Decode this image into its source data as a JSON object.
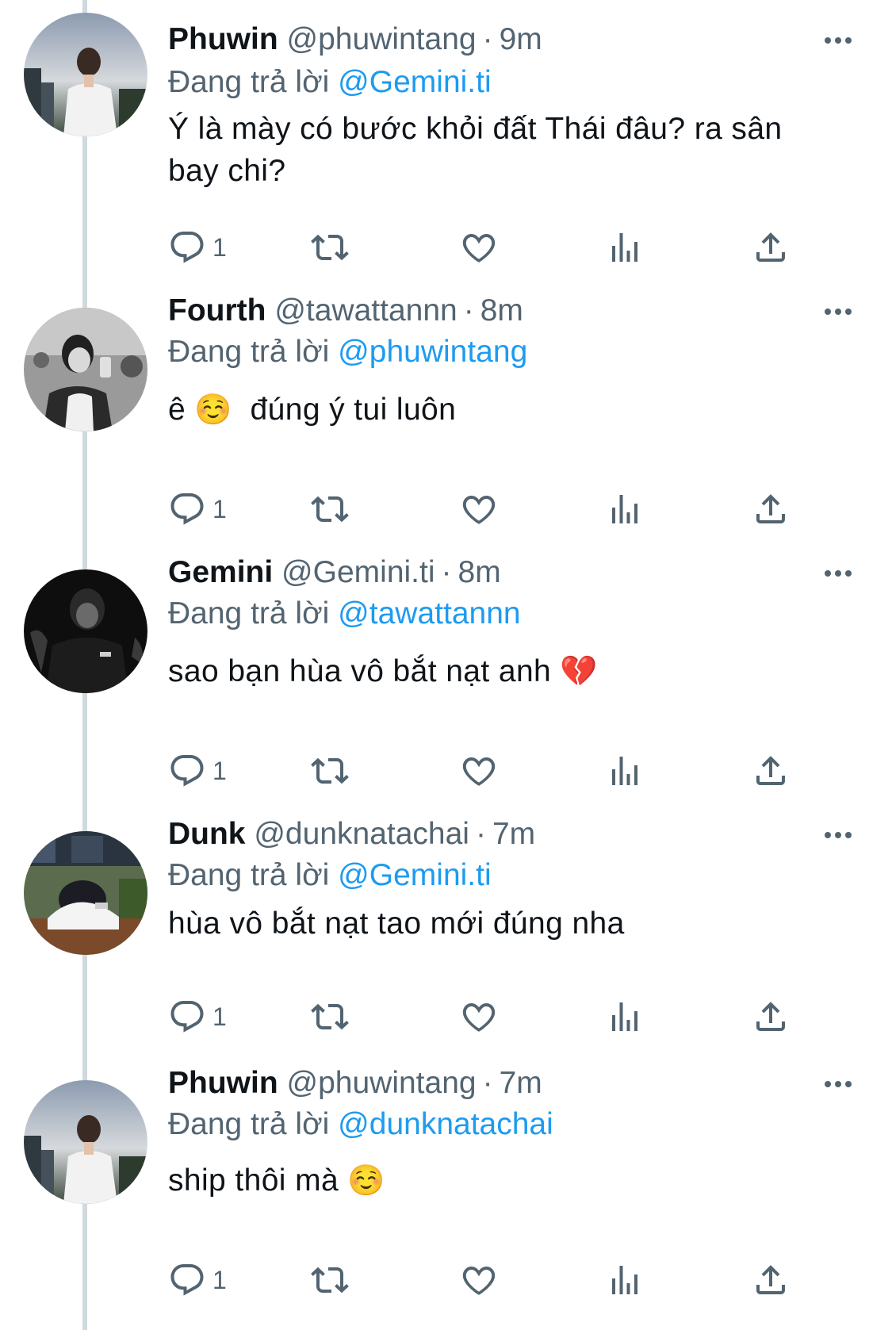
{
  "tweets": [
    {
      "name": "Phuwin",
      "handle": "@phuwintang",
      "separator": "·",
      "time": "9m",
      "reply_prefix": "Đang trả lời",
      "reply_to": "@Gemini.ti",
      "body_line1": "Ý là mày có bước khỏi đất Thái đâu? ra sân",
      "body_line2": "bay chi?",
      "reply_count": "1",
      "avatar": "phuwin-avatar"
    },
    {
      "name": "Fourth",
      "handle": "@tawattannn",
      "separator": "·",
      "time": "8m",
      "reply_prefix": "Đang trả lời",
      "reply_to": "@phuwintang",
      "body_text": "ê",
      "body_emoji": "☺️",
      "body_text2": "đúng ý tui luôn",
      "reply_count": "1",
      "avatar": "fourth-avatar"
    },
    {
      "name": "Gemini",
      "handle": "@Gemini.ti",
      "separator": "·",
      "time": "8m",
      "reply_prefix": "Đang trả lời",
      "reply_to": "@tawattannn",
      "body_text": "sao bạn hùa vô bắt nạt anh",
      "body_emoji": "💔",
      "reply_count": "1",
      "avatar": "gemini-avatar"
    },
    {
      "name": "Dunk",
      "handle": "@dunknatachai",
      "separator": "·",
      "time": "7m",
      "reply_prefix": "Đang trả lời",
      "reply_to": "@Gemini.ti",
      "body_text": "hùa vô bắt nạt tao mới đúng nha",
      "reply_count": "1",
      "avatar": "dunk-avatar"
    },
    {
      "name": "Phuwin",
      "handle": "@phuwintang",
      "separator": "·",
      "time": "7m",
      "reply_prefix": "Đang trả lời",
      "reply_to": "@dunknatachai",
      "body_text": "ship thôi mà",
      "body_emoji": "☺️",
      "reply_count": "1",
      "avatar": "phuwin-avatar"
    }
  ],
  "icons": {
    "more": "more-horizontal-icon",
    "reply": "reply-bubble-icon",
    "retweet": "retweet-icon",
    "like": "heart-icon",
    "views": "analytics-bars-icon",
    "share": "share-upload-icon"
  },
  "colors": {
    "text_primary": "#0f1419",
    "text_secondary": "#536471",
    "link": "#1d9bf0",
    "thread_line": "#cfd9de"
  }
}
